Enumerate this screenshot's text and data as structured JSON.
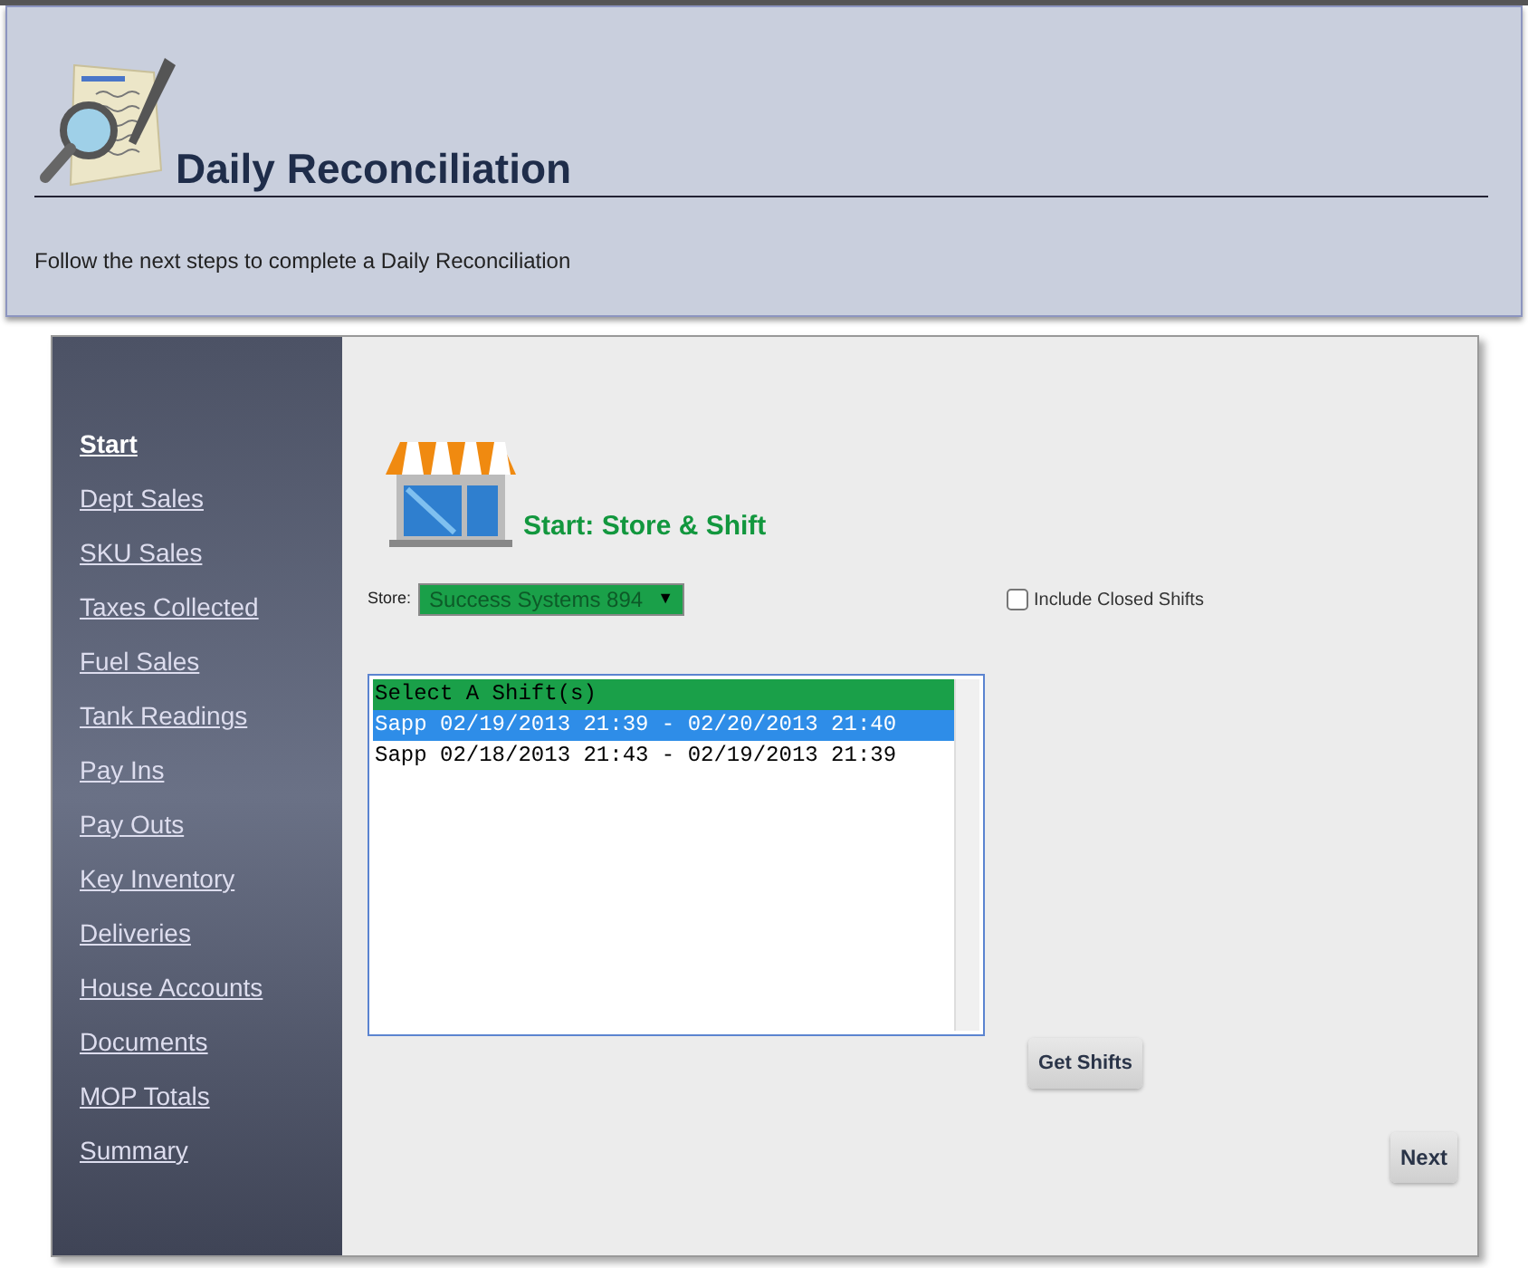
{
  "header": {
    "title": "Daily Reconciliation",
    "subtitle": "Follow the next steps to complete a Daily Reconciliation"
  },
  "sidebar": {
    "items": [
      {
        "label": "Start",
        "selected": true
      },
      {
        "label": "Dept Sales",
        "selected": false
      },
      {
        "label": "SKU Sales",
        "selected": false
      },
      {
        "label": "Taxes Collected",
        "selected": false
      },
      {
        "label": "Fuel Sales",
        "selected": false
      },
      {
        "label": "Tank Readings",
        "selected": false
      },
      {
        "label": "Pay Ins",
        "selected": false
      },
      {
        "label": "Pay Outs",
        "selected": false
      },
      {
        "label": "Key Inventory",
        "selected": false
      },
      {
        "label": "Deliveries",
        "selected": false
      },
      {
        "label": "House Accounts",
        "selected": false
      },
      {
        "label": "Documents",
        "selected": false
      },
      {
        "label": "MOP Totals",
        "selected": false
      },
      {
        "label": "Summary",
        "selected": false
      }
    ]
  },
  "section_title": "Start: Store & Shift",
  "store": {
    "label": "Store:",
    "value": "Success Systems 894",
    "caret": "▼"
  },
  "include_closed_shifts": {
    "label": "Include Closed Shifts",
    "checked": false
  },
  "shift_list": {
    "header": "Select A Shift(s)",
    "items": [
      {
        "label": "Sapp 02/19/2013 21:39 - 02/20/2013 21:40",
        "selected": true
      },
      {
        "label": "Sapp 02/18/2013 21:43 - 02/19/2013 21:39",
        "selected": false
      }
    ]
  },
  "buttons": {
    "get_shifts": "Get Shifts",
    "next": "Next"
  }
}
